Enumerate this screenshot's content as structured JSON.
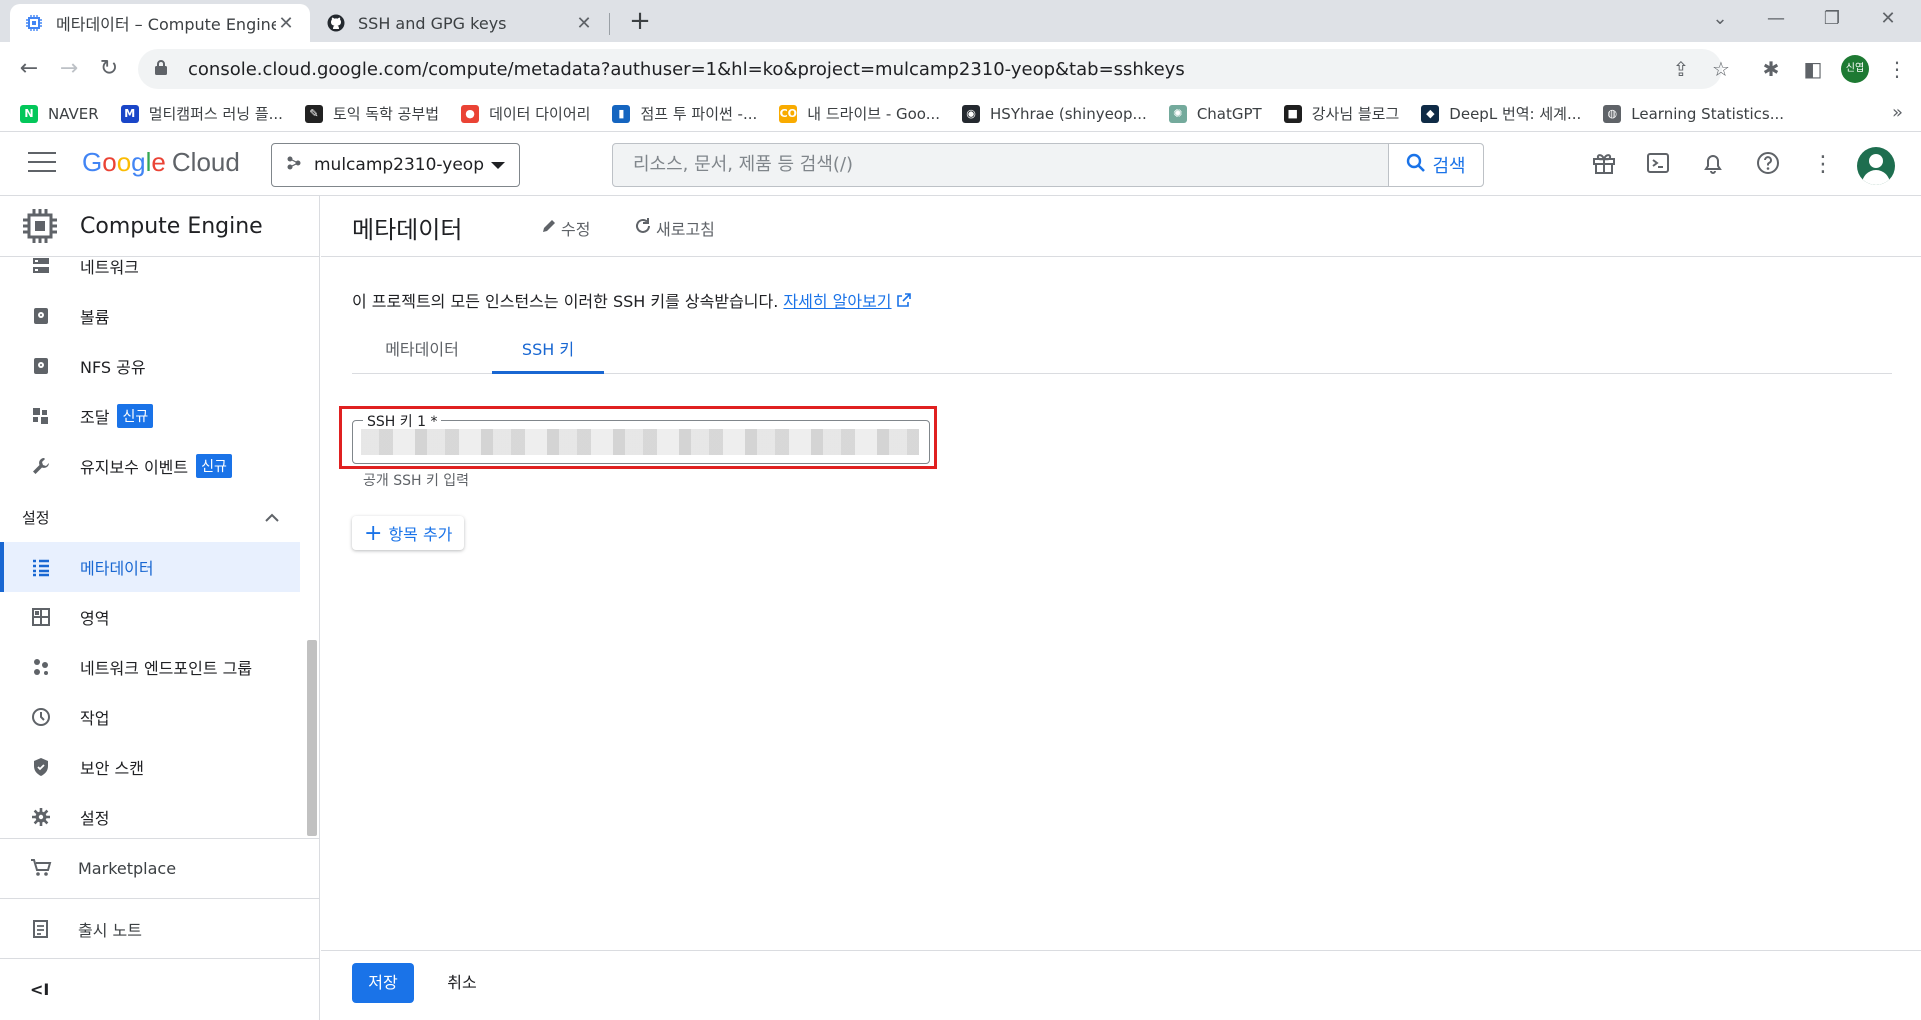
{
  "browser": {
    "tabs": [
      {
        "title": "메타데이터 – Compute Engine",
        "active": true
      },
      {
        "title": "SSH and GPG keys",
        "active": false
      }
    ],
    "url": "console.cloud.google.com/compute/metadata?authuser=1&hl=ko&project=mulcamp2310-yeop&tab=sshkeys",
    "profile_label": "신엽",
    "bookmarks": [
      {
        "label": "NAVER",
        "color": "#03c75a",
        "glyph": "N"
      },
      {
        "label": "멀티캠퍼스 러닝 플...",
        "color": "#1a46c8",
        "glyph": "M"
      },
      {
        "label": "토익 독학 공부법",
        "color": "#222222",
        "glyph": "✎"
      },
      {
        "label": "데이터 다이어리",
        "color": "#ea4335",
        "glyph": "●"
      },
      {
        "label": "점프 투 파이썬 -...",
        "color": "#1565c0",
        "glyph": "▮"
      },
      {
        "label": "내 드라이브 - Goo...",
        "color": "#f9ab00",
        "glyph": "CO"
      },
      {
        "label": "HSYhrae (shinyeop...",
        "color": "#24292f",
        "glyph": "◉"
      },
      {
        "label": "ChatGPT",
        "color": "#74aa9c",
        "glyph": "✺"
      },
      {
        "label": "강사님 블로그",
        "color": "#1f1f1f",
        "glyph": "■"
      },
      {
        "label": "DeepL 번역: 세계...",
        "color": "#0f2b46",
        "glyph": "◆"
      },
      {
        "label": "Learning Statistics...",
        "color": "#5f6368",
        "glyph": "◍"
      }
    ]
  },
  "header": {
    "logo_google": "Google",
    "logo_cloud": "Cloud",
    "project": "mulcamp2310-yeop",
    "search_placeholder": "리소스, 문서, 제품 등 검색(/)",
    "search_button": "검색"
  },
  "sidebar": {
    "product": "Compute Engine",
    "items_top": [
      {
        "label": "네트워크",
        "icon": "network-icon"
      },
      {
        "label": "볼륨",
        "icon": "disk-icon"
      },
      {
        "label": "NFS 공유",
        "icon": "nfs-icon"
      },
      {
        "label": "조달",
        "icon": "procurement-icon",
        "badge": "신규"
      },
      {
        "label": "유지보수 이벤트",
        "icon": "wrench-icon",
        "badge": "신규"
      }
    ],
    "section_label": "설정",
    "items_settings": [
      {
        "label": "메타데이터",
        "icon": "list-icon",
        "active": true
      },
      {
        "label": "영역",
        "icon": "zones-icon"
      },
      {
        "label": "네트워크 엔드포인트 그룹",
        "icon": "endpoint-group-icon"
      },
      {
        "label": "작업",
        "icon": "clock-icon"
      },
      {
        "label": "보안 스캔",
        "icon": "shield-icon"
      },
      {
        "label": "설정",
        "icon": "gear-icon"
      }
    ],
    "marketplace": "Marketplace",
    "release_notes": "출시 노트",
    "collapse": "<I"
  },
  "main": {
    "title": "메타데이터",
    "edit": "수정",
    "refresh": "새로고침",
    "description": "이 프로젝트의 모든 인스턴스는 이러한 SSH 키를 상속받습니다.",
    "learn_more": "자세히 알아보기",
    "tabs": [
      "메타데이터",
      "SSH 키"
    ],
    "ssh_key_label": "SSH 키 1 *",
    "ssh_hint": "공개 SSH 키 입력",
    "add_item": "항목 추가",
    "save": "저장",
    "cancel": "취소"
  },
  "colors": {
    "primary": "#1a73e8",
    "highlight_box": "#e02020",
    "active_bg": "#e8f0fe"
  }
}
